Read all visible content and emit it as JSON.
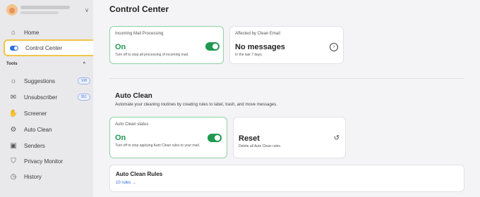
{
  "sidebar": {
    "items": [
      {
        "label": "Home",
        "icon": "home-icon"
      },
      {
        "label": "Control Center",
        "icon": "toggle-icon"
      },
      {
        "label": "Suggestions",
        "icon": "lightbulb-icon",
        "badge": "108"
      },
      {
        "label": "Unsubscriber",
        "icon": "unsubscribe-icon",
        "badge": "261"
      },
      {
        "label": "Screener",
        "icon": "hand-icon"
      },
      {
        "label": "Auto Clean",
        "icon": "auto-clean-icon"
      },
      {
        "label": "Senders",
        "icon": "senders-icon"
      },
      {
        "label": "Privacy Monitor",
        "icon": "shield-icon"
      },
      {
        "label": "History",
        "icon": "clock-icon"
      }
    ],
    "tools_label": "Tools",
    "tools_chevron": "^",
    "account_chevron": "v"
  },
  "main": {
    "title": "Control Center",
    "incoming": {
      "label": "Incoming Mail Processing",
      "value": "On",
      "sub": "Turn off to stop all processing of incoming mail."
    },
    "affected": {
      "label": "Affected by Clean Email",
      "value": "No messages",
      "sub": "In the last 7 days."
    },
    "auto_clean": {
      "title": "Auto Clean",
      "desc": "Automate your cleaning routines by creating rules to label, trash, and move messages.",
      "status": {
        "label": "Auto Clean status",
        "value": "On",
        "sub": "Turn off to stop applying Auto Clean rules to your mail."
      },
      "reset": {
        "title": "Reset",
        "sub": "Delete all Auto Clean rules."
      },
      "rules": {
        "title": "Auto Clean Rules",
        "link": "10 rules →"
      }
    }
  },
  "colors": {
    "accent_green": "#1f9950",
    "highlight_yellow": "#f2c548",
    "link_blue": "#2e69d6"
  }
}
